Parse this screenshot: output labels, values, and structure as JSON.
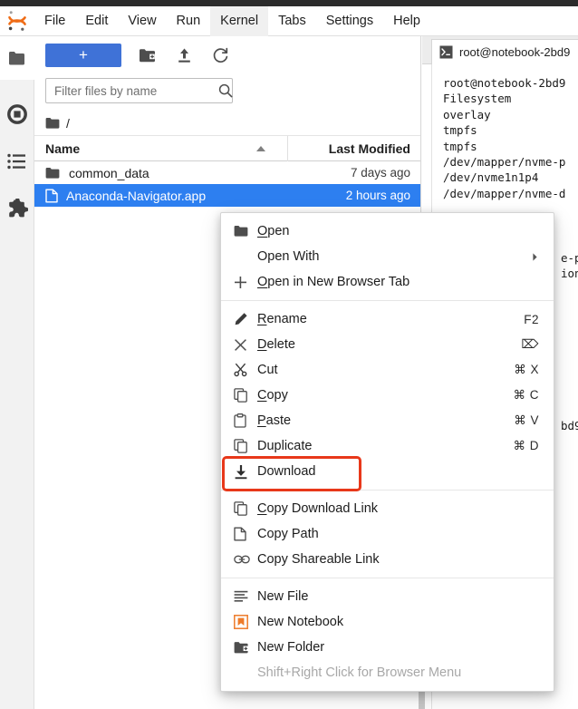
{
  "menubar": {
    "logo": "jupyter-logo",
    "items": [
      {
        "label": "File",
        "active": false
      },
      {
        "label": "Edit",
        "active": false
      },
      {
        "label": "View",
        "active": false
      },
      {
        "label": "Run",
        "active": false
      },
      {
        "label": "Kernel",
        "active": true
      },
      {
        "label": "Tabs",
        "active": false
      },
      {
        "label": "Settings",
        "active": false
      },
      {
        "label": "Help",
        "active": false
      }
    ]
  },
  "activitybar": {
    "items": [
      {
        "name": "file-browser-icon"
      },
      {
        "name": "running-terminals-icon"
      },
      {
        "name": "commands-list-icon"
      },
      {
        "name": "extensions-puzzle-icon"
      }
    ]
  },
  "filebrowser": {
    "new_launcher_label": "+",
    "toolbar": [
      {
        "name": "new-folder-icon"
      },
      {
        "name": "upload-icon"
      },
      {
        "name": "refresh-icon"
      }
    ],
    "filter_placeholder": "Filter files by name",
    "filter_value": "",
    "breadcrumb": "/",
    "columns": {
      "name": "Name",
      "last_modified": "Last Modified"
    },
    "sort": "ascending",
    "rows": [
      {
        "name": "common_data",
        "modified": "7 days ago",
        "type": "folder",
        "selected": false
      },
      {
        "name": "Anaconda-Navigator.app",
        "modified": "2 hours ago",
        "type": "file",
        "selected": true
      }
    ]
  },
  "terminal": {
    "tab_title": "root@notebook-2bd9",
    "tab_icon": "terminal-icon",
    "lines": [
      "root@notebook-2bd9",
      "Filesystem",
      "overlay",
      "tmpfs",
      "tmpfs",
      "/dev/mapper/nvme-p",
      "/dev/nvme1n1p4",
      "/dev/mapper/nvme-d"
    ],
    "clipped_lines": [
      "e-p",
      "ion",
      "bd9"
    ]
  },
  "contextmenu": {
    "groups": [
      {
        "items": [
          {
            "label": "Open",
            "mnemonic": "O",
            "icon": "folder-icon",
            "shortcut": "",
            "submenu": false,
            "disabled": false,
            "highlighted": false
          },
          {
            "label": "Open With",
            "mnemonic": "",
            "icon": "",
            "shortcut": "",
            "submenu": true,
            "disabled": false,
            "highlighted": false
          },
          {
            "label": "Open in New Browser Tab",
            "mnemonic": "O",
            "icon": "plus-icon",
            "shortcut": "",
            "submenu": false,
            "disabled": false,
            "highlighted": false
          }
        ]
      },
      {
        "items": [
          {
            "label": "Rename",
            "mnemonic": "R",
            "icon": "pencil-icon",
            "shortcut": "F2",
            "submenu": false,
            "disabled": false,
            "highlighted": false
          },
          {
            "label": "Delete",
            "mnemonic": "D",
            "icon": "close-x-icon",
            "shortcut": "⌦",
            "submenu": false,
            "disabled": false,
            "highlighted": false
          },
          {
            "label": "Cut",
            "mnemonic": "",
            "icon": "scissors-icon",
            "shortcut": "⌘ X",
            "submenu": false,
            "disabled": false,
            "highlighted": false
          },
          {
            "label": "Copy",
            "mnemonic": "C",
            "icon": "copy-icon",
            "shortcut": "⌘ C",
            "submenu": false,
            "disabled": false,
            "highlighted": false
          },
          {
            "label": "Paste",
            "mnemonic": "P",
            "icon": "clipboard-icon",
            "shortcut": "⌘ V",
            "submenu": false,
            "disabled": false,
            "highlighted": false
          },
          {
            "label": "Duplicate",
            "mnemonic": "",
            "icon": "copy-icon",
            "shortcut": "⌘ D",
            "submenu": false,
            "disabled": false,
            "highlighted": false
          },
          {
            "label": "Download",
            "mnemonic": "",
            "icon": "download-icon",
            "shortcut": "",
            "submenu": false,
            "disabled": false,
            "highlighted": true
          }
        ]
      },
      {
        "items": [
          {
            "label": "Copy Download Link",
            "mnemonic": "C",
            "icon": "copy-icon",
            "shortcut": "",
            "submenu": false,
            "disabled": false,
            "highlighted": false
          },
          {
            "label": "Copy Path",
            "mnemonic": "",
            "icon": "file-icon",
            "shortcut": "",
            "submenu": false,
            "disabled": false,
            "highlighted": false
          },
          {
            "label": "Copy Shareable Link",
            "mnemonic": "",
            "icon": "link-icon",
            "shortcut": "",
            "submenu": false,
            "disabled": false,
            "highlighted": false
          }
        ]
      },
      {
        "items": [
          {
            "label": "New File",
            "mnemonic": "",
            "icon": "text-lines-icon",
            "shortcut": "",
            "submenu": false,
            "disabled": false,
            "highlighted": false
          },
          {
            "label": "New Notebook",
            "mnemonic": "",
            "icon": "notebook-icon",
            "shortcut": "",
            "submenu": false,
            "disabled": false,
            "highlighted": false
          },
          {
            "label": "New Folder",
            "mnemonic": "",
            "icon": "new-folder-icon",
            "shortcut": "",
            "submenu": false,
            "disabled": false,
            "highlighted": false
          },
          {
            "label": "Shift+Right Click for Browser Menu",
            "mnemonic": "",
            "icon": "",
            "shortcut": "",
            "submenu": false,
            "disabled": true,
            "highlighted": false
          }
        ]
      }
    ]
  },
  "colors": {
    "accent_blue": "#3f72d7",
    "selection_blue": "#2d7ff0",
    "highlight_red": "#e8381a",
    "notebook_orange": "#ee7b29",
    "menubar_active_bg": "#f0f0f0"
  }
}
